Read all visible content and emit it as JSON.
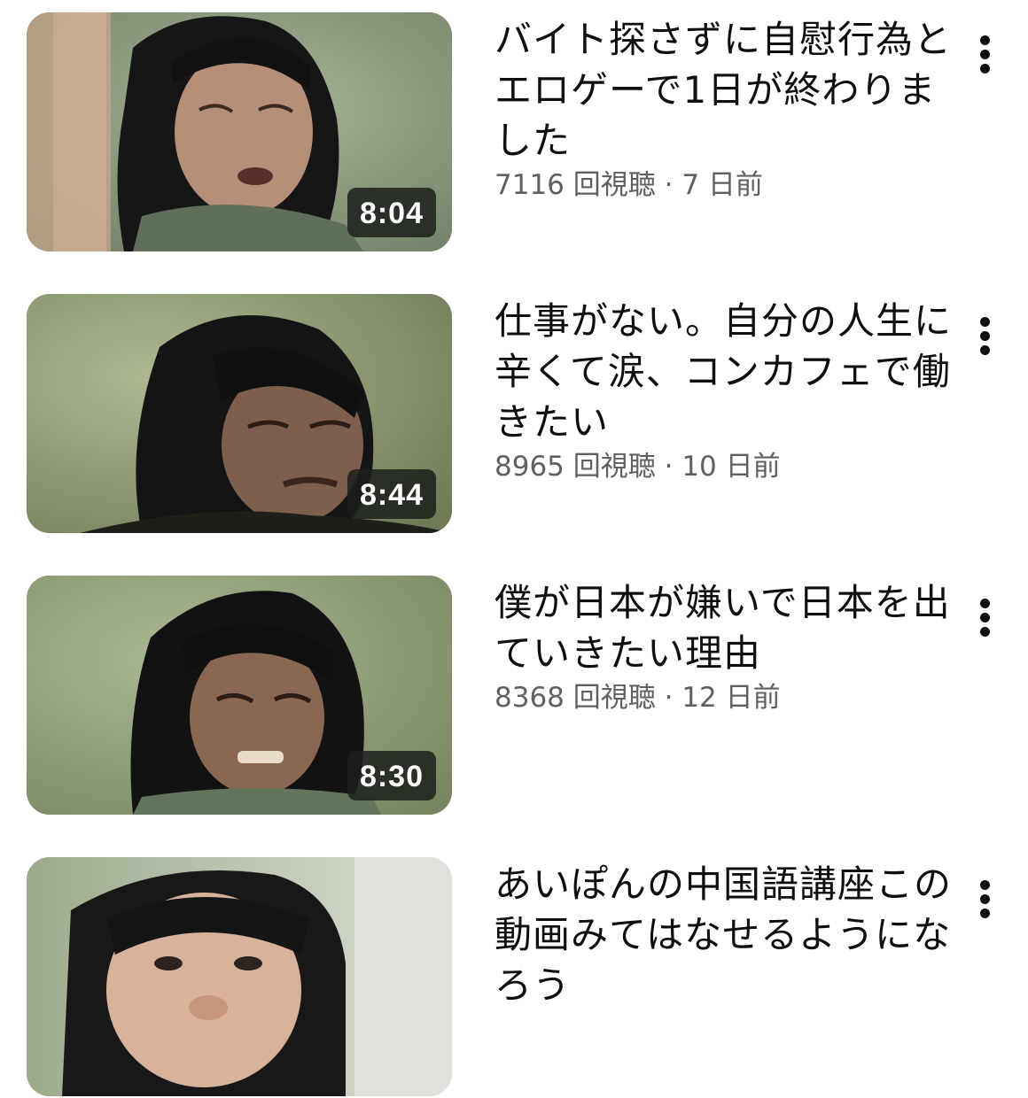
{
  "videos": [
    {
      "title": "バイト探さずに自慰行為とエロゲーで1日が終わりました",
      "views": "7116 回視聴",
      "separator": "·",
      "age": "7 日前",
      "duration": "8:04",
      "menu_icon": "more-vert-icon"
    },
    {
      "title": "仕事がない。自分の人生に辛くて涙、コンカフェで働きたい",
      "views": "8965 回視聴",
      "separator": "·",
      "age": "10 日前",
      "duration": "8:44",
      "menu_icon": "more-vert-icon"
    },
    {
      "title": "僕が日本が嫌いで日本を出ていきたい理由",
      "views": "8368 回視聴",
      "separator": "·",
      "age": "12 日前",
      "duration": "8:30",
      "menu_icon": "more-vert-icon"
    },
    {
      "title": "あいぽんの中国語講座この動画みてはなせるようになろう",
      "views": "",
      "separator": "",
      "age": "",
      "duration": "",
      "menu_icon": "more-vert-icon"
    }
  ]
}
